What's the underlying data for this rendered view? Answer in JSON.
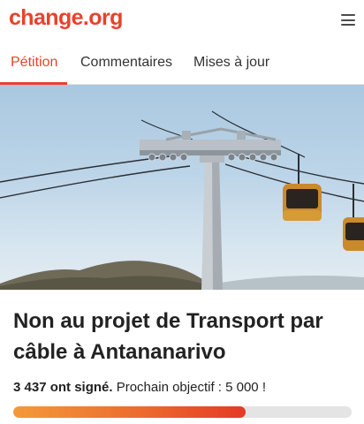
{
  "header": {
    "logo_text": "change.org",
    "menu_icon": "hamburger-menu-icon",
    "brand_color": "#e8422b"
  },
  "tabs": [
    {
      "label": "Pétition",
      "active": true
    },
    {
      "label": "Commentaires",
      "active": false
    },
    {
      "label": "Mises à jour",
      "active": false
    }
  ],
  "hero": {
    "image_subject": "cable car pylon with gondolas against sky"
  },
  "petition": {
    "title": "Non au projet de Transport par câble à Antananarivo",
    "signed_count": "3 437 ont signé.",
    "next_goal_text": "Prochain objectif : 5 000 !",
    "progress": 0.687
  }
}
